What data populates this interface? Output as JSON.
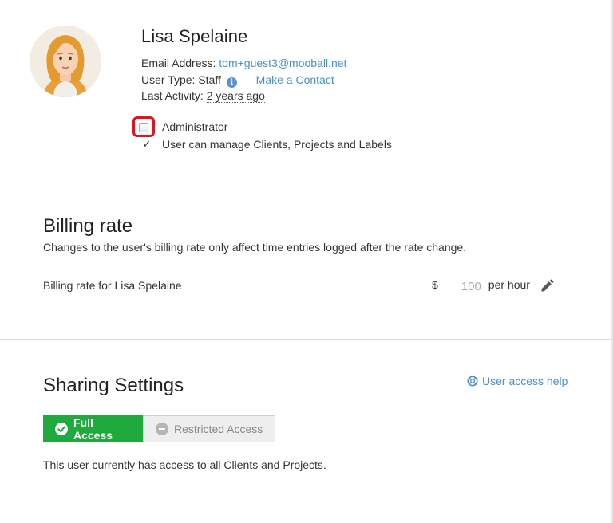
{
  "profile": {
    "name": "Lisa Spelaine",
    "email_label": "Email Address:",
    "email": "tom+guest3@mooball.net",
    "user_type_label": "User Type:",
    "user_type": "Staff",
    "make_contact_label": "Make a Contact",
    "last_activity_label": "Last Activity:",
    "last_activity": "2 years ago",
    "avatar_icon": "female-avatar-icon"
  },
  "permissions": {
    "administrator_label": "Administrator",
    "administrator_checked": false,
    "manage_label": "User can manage Clients, Projects and Labels",
    "manage_checked": true
  },
  "billing": {
    "title": "Billing rate",
    "description": "Changes to the user's billing rate only affect time entries logged after the rate change.",
    "row_label": "Billing rate for Lisa Spelaine",
    "currency": "$",
    "rate_value": "100",
    "per_hour": "per hour",
    "edit_icon": "pencil-icon"
  },
  "sharing": {
    "title": "Sharing Settings",
    "help_label": "User access help",
    "full_access_label": "Full Access",
    "restricted_access_label": "Restricted Access",
    "access_note": "This user currently has access to all Clients and Projects."
  },
  "colors": {
    "link": "#4a90c9",
    "full_access_bg": "#1eaa3c",
    "highlight_frame": "#e0141e"
  }
}
